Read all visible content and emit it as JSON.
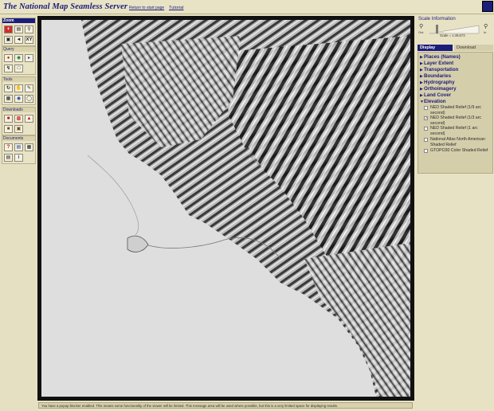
{
  "header": {
    "title": "The National Map Seamless Server",
    "return_link": "Return to start page",
    "tutorial_link": "Tutorial"
  },
  "toolbar": {
    "zoom_title": "Zoom",
    "query_title": "Query",
    "tools_title": "Tools",
    "downloads_title": "Downloads",
    "documents_title": "Documents",
    "xy_label": "XY"
  },
  "scale": {
    "title": "Scale Information",
    "zoom_out_label": "Out",
    "zoom_in_label": "In",
    "scale_text": "Scale = 1:49,673"
  },
  "tabs": {
    "display": "Display",
    "download": "Download"
  },
  "layers": {
    "groups": [
      "Places (Names)",
      "Layer Extent",
      "Transportation",
      "Boundaries",
      "Hydrography",
      "Orthoimagery",
      "Land Cover",
      "Elevation"
    ],
    "elevation_items": [
      {
        "label": "NED Shaded Relief (1/9 arc second)",
        "checked": false
      },
      {
        "label": "NED Shaded Relief (1/3 arc second)",
        "checked": true
      },
      {
        "label": "NED Shaded Relief (1 arc second)",
        "checked": false
      },
      {
        "label": "National Atlas North American Shaded Relief",
        "checked": false
      },
      {
        "label": "GTOPO30 Color Shaded Relief",
        "checked": false
      }
    ]
  },
  "status": {
    "message": "You have a popup blocker enabled. This means some functionality of the viewer will be limited. This message area will be used where possible, but this is a very limited space for displaying results."
  },
  "colors": {
    "navy": "#1b1d7a",
    "panel_bg": "#e8e2c4",
    "accent_red": "#d12b2b"
  }
}
